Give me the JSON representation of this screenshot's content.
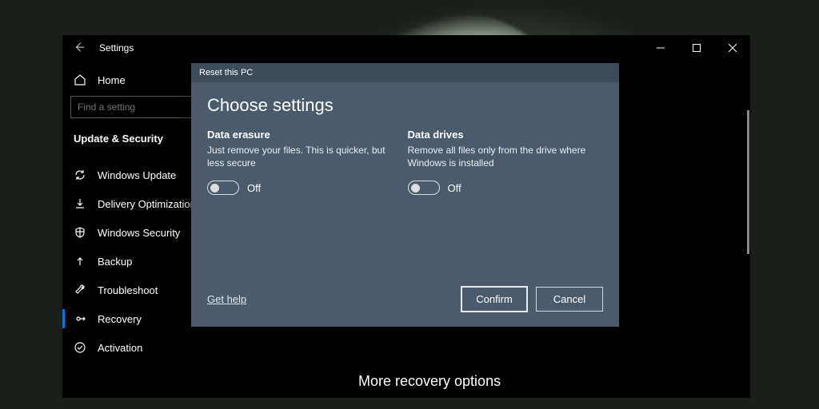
{
  "window": {
    "title": "Settings",
    "home_label": "Home",
    "search_placeholder": "Find a setting",
    "section_title": "Update & Security",
    "nav": [
      {
        "label": "Windows Update"
      },
      {
        "label": "Delivery Optimization"
      },
      {
        "label": "Windows Security"
      },
      {
        "label": "Backup"
      },
      {
        "label": "Troubleshoot"
      },
      {
        "label": "Recovery"
      },
      {
        "label": "Activation"
      }
    ],
    "active_nav_index": 5,
    "main_heading": "More recovery options"
  },
  "dialog": {
    "title": "Reset this PC",
    "heading": "Choose settings",
    "options": [
      {
        "title": "Data erasure",
        "desc": "Just remove your files. This is quicker, but less secure",
        "toggle_state": "Off"
      },
      {
        "title": "Data drives",
        "desc": "Remove all files only from the drive where Windows is installed",
        "toggle_state": "Off"
      }
    ],
    "get_help": "Get help",
    "confirm": "Confirm",
    "cancel": "Cancel"
  }
}
